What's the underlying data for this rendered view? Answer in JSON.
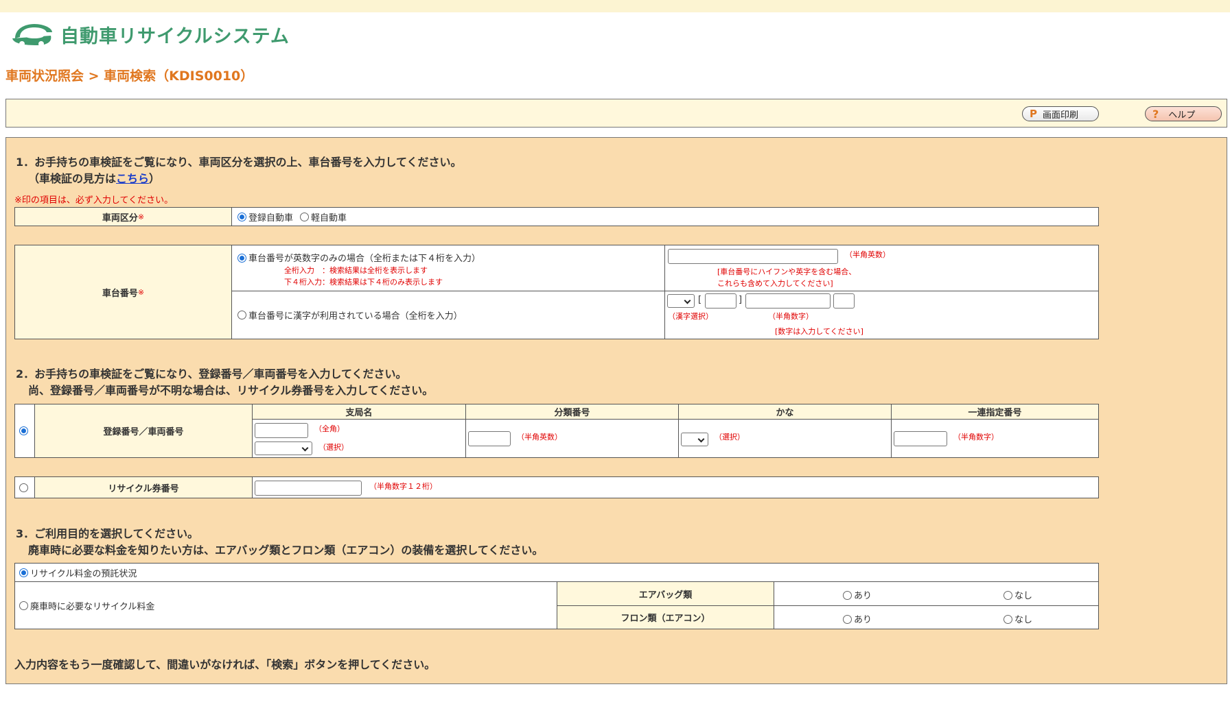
{
  "app": {
    "title": "自動車リサイクルシステム"
  },
  "breadcrumb": "車両状況照会 > 車両検索（KDIS0010）",
  "toolbar": {
    "print_label": "画面印刷",
    "print_icon": "P",
    "help_label": "ヘルプ",
    "help_icon": "?"
  },
  "section1": {
    "line1": "1．お手持ちの車検証をご覧になり、車両区分を選択の上、車台番号を入力してください。",
    "line2_prefix": "（車検証の見方は",
    "line2_link": "こちら",
    "line2_suffix": "）",
    "required_note": "※印の項目は、必ず入力してください。",
    "vehicle_type": {
      "label": "車両区分",
      "required_mark": "※",
      "options": [
        {
          "label": "登録自動車",
          "selected": true
        },
        {
          "label": "軽自動車",
          "selected": false
        }
      ]
    },
    "chassis": {
      "label": "車台番号",
      "required_mark": "※",
      "option1": {
        "label": "車台番号が英数字のみの場合（全桁または下４桁を入力）",
        "selected": true,
        "note1": "全桁入力　：検索結果は全桁を表示します",
        "note2": "下４桁入力：検索結果は下４桁のみ表示します",
        "input_hint": "（半角英数）",
        "hint_line1": "[車台番号にハイフンや英字を含む場合、",
        "hint_line2": "これらも含めて入力してください]"
      },
      "option2": {
        "label": "車台番号に漢字が利用されている場合（全桁を入力）",
        "selected": false,
        "bracket_open": "[",
        "bracket_close": "]",
        "kanji_hint": "（漢字選択）",
        "num_hint": "（半角数字）",
        "digits_note": "[数字は入力してください]"
      }
    }
  },
  "section2": {
    "line1": "2．お手持ちの車検証をご覧になり、登録番号／車両番号を入力してください。",
    "line2": "尚、登録番号／車両番号が不明な場合は、リサイクル券番号を入力してください。",
    "reg": {
      "label": "登録番号／車両番号",
      "selected": true,
      "columns": [
        "支局名",
        "分類番号",
        "かな",
        "一連指定番号"
      ],
      "branch_hint1": "（全角）",
      "branch_hint2": "（選択）",
      "class_hint": "（半角英数）",
      "kana_hint": "（選択）",
      "serial_hint": "（半角数字）"
    },
    "ticket": {
      "label": "リサイクル券番号",
      "selected": false,
      "hint": "（半角数字１２桁）"
    }
  },
  "section3": {
    "line1": "3．ご利用目的を選択してください。",
    "line2": "廃車時に必要な料金を知りたい方は、エアバッグ類とフロン類（エアコン）の装備を選択してください。",
    "purpose1": {
      "label": "リサイクル料金の預託状況",
      "selected": true
    },
    "purpose2": {
      "label": "廃車時に必要なリサイクル料金",
      "selected": false
    },
    "airbag": {
      "label": "エアバッグ類",
      "yes": "あり",
      "no": "なし"
    },
    "freon": {
      "label": "フロン類（エアコン）",
      "yes": "あり",
      "no": "なし"
    }
  },
  "footer_note": "入力内容をもう一度確認して、間違いがなければ、「検索」ボタンを押してください。",
  "colors": {
    "accent": "#e0771f",
    "logo_green": "#3f9a6e",
    "panel": "#fadcae",
    "header_cell": "#fff8dc",
    "required": "#e00000"
  }
}
